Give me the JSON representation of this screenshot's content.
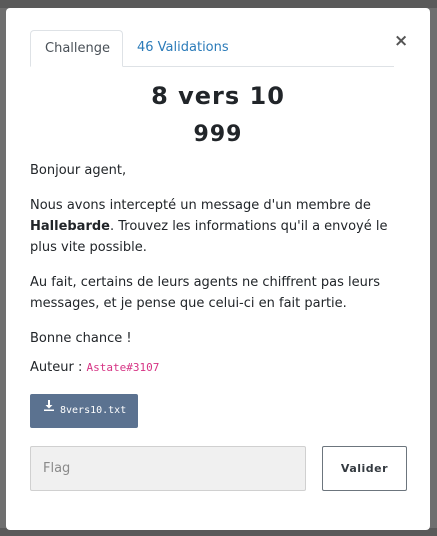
{
  "tabs": [
    {
      "label": "Challenge",
      "active": true
    },
    {
      "label": "46 Validations",
      "active": false
    }
  ],
  "close_label": "×",
  "challenge": {
    "title": "8 vers 10",
    "score": "999"
  },
  "description": {
    "greeting": "Bonjour agent,",
    "p2_before": "Nous avons intercepté un message d'un membre de ",
    "p2_bold": "Hallebarde",
    "p2_after": ". Trouvez les informations qu'il a envoyé le plus vite possible.",
    "p3": "Au fait, certains de leurs agents ne chiffrent pas leurs messages, et je pense que celui-ci en fait partie.",
    "p4": "Bonne chance !"
  },
  "author": {
    "label": "Auteur : ",
    "name": "Astate#3107"
  },
  "file": {
    "name": "8vers10.txt",
    "icon": "download-icon"
  },
  "flag_input": {
    "placeholder": "Flag",
    "value": ""
  },
  "submit_label": "Valider",
  "colors": {
    "tab_link": "#2b7bb9",
    "author_link": "#d63384",
    "file_button_bg": "#5b7290",
    "modal_bg": "#ffffff",
    "backdrop": "#6f6f6f"
  }
}
